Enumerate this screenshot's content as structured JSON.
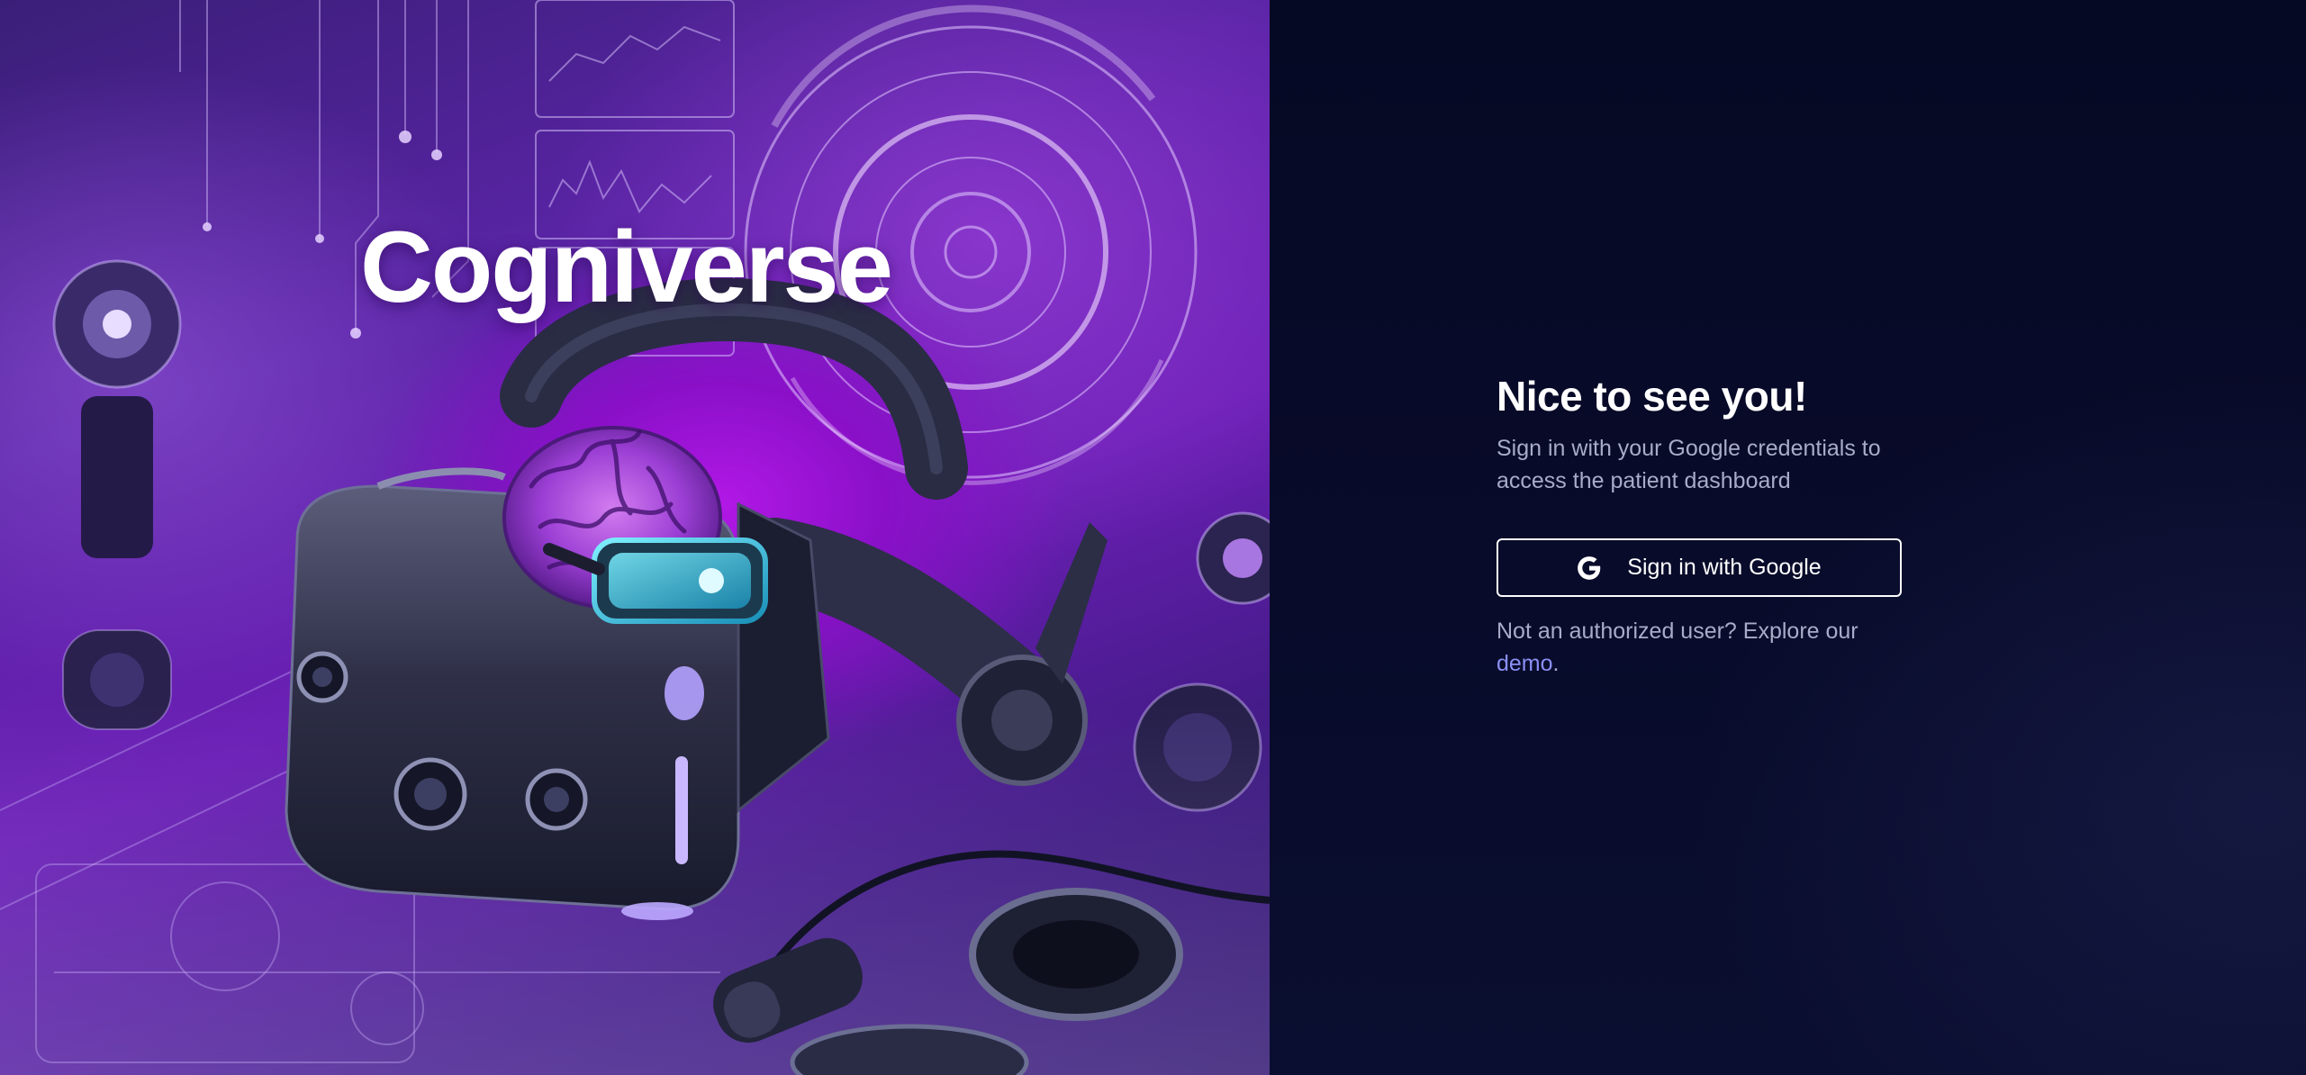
{
  "hero": {
    "brand_title": "Cogniverse",
    "image_alt": "Illustration of a VR headset with a glowing purple brain wearing mini VR goggles, surrounded by futuristic tech devices"
  },
  "signin": {
    "heading": "Nice to see you!",
    "subtitle": "Sign in with your Google credentials to access the patient dashboard",
    "google_button_label": "Sign in with Google",
    "alt_text": "Not an authorized user? Explore our",
    "demo_link_label": "demo",
    "alt_suffix": "."
  },
  "colors": {
    "panel_bg": "#070a24",
    "accent_link": "#8b8ff5",
    "muted_text": "#a8acc8",
    "hero_purple": "#8a10c8"
  },
  "icons": {
    "google": "google-g-icon"
  }
}
